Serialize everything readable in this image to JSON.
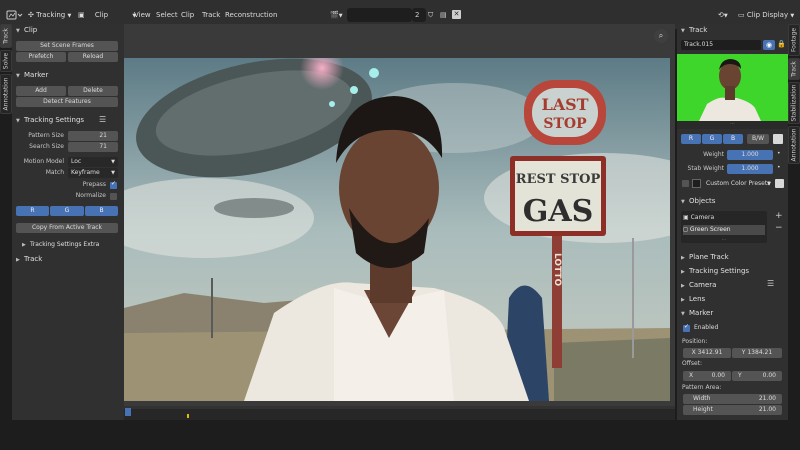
{
  "header": {
    "workspace_label": "Tracking",
    "mode_label": "Clip",
    "menu": [
      "View",
      "Select",
      "Clip",
      "Track",
      "Reconstruction"
    ],
    "frame_number": "2",
    "display_label": "Clip Display"
  },
  "left_tabs": [
    "Track",
    "Solve",
    "Annotation"
  ],
  "right_tabs": [
    "Footage",
    "Track",
    "Stabilization",
    "Annotation"
  ],
  "left_panel": {
    "clip": {
      "title": "Clip",
      "set_scene_frames": "Set Scene Frames",
      "prefetch": "Prefetch",
      "reload": "Reload"
    },
    "marker": {
      "title": "Marker",
      "add": "Add",
      "delete": "Delete",
      "detect_features": "Detect Features"
    },
    "tracking_settings": {
      "title": "Tracking Settings",
      "pattern_size_label": "Pattern Size",
      "pattern_size": "21",
      "search_size_label": "Search Size",
      "search_size": "71",
      "motion_model_label": "Motion Model",
      "motion_model": "Loc",
      "match_label": "Match",
      "match": "Keyframe",
      "prepass_label": "Prepass",
      "normalize_label": "Normalize",
      "r": "R",
      "g": "G",
      "b": "B",
      "copy_from_active": "Copy From Active Track",
      "extra": "Tracking Settings Extra"
    },
    "track_title": "Track"
  },
  "clip": {
    "sign_top": "LAST",
    "sign_top2": "STOP",
    "sign_mid": "REST STOP",
    "sign_gas": "GAS",
    "sign_lotto": "LOTTO"
  },
  "right_panel": {
    "track": {
      "title": "Track",
      "name": "Track.015",
      "r": "R",
      "g": "G",
      "b": "B",
      "bw": "B/W",
      "weight_label": "Weight",
      "weight": "1.000",
      "stab_weight_label": "Stab Weight",
      "stab_weight": "1.000",
      "custom_presets": "Custom Color Presets"
    },
    "objects": {
      "title": "Objects",
      "items": [
        "Camera",
        "Green Screen"
      ]
    },
    "collapsed": [
      "Plane Track",
      "Tracking Settings",
      "Camera",
      "Lens"
    ],
    "marker": {
      "title": "Marker",
      "enabled_label": "Enabled",
      "position_label": "Position:",
      "pos_x": "X  3412.91",
      "pos_y": "Y  1384.21",
      "offset_label": "Offset:",
      "off_x_label": "X",
      "off_x": "0.00",
      "off_y_label": "Y",
      "off_y": "0.00",
      "pattern_area_label": "Pattern Area:",
      "width_label": "Width",
      "width": "21.00",
      "height_label": "Height",
      "height": "21.00"
    }
  },
  "colors": {
    "accent_blue": "#4772b3",
    "panel_bg": "#303030",
    "green_screen": "#3ed62a"
  }
}
